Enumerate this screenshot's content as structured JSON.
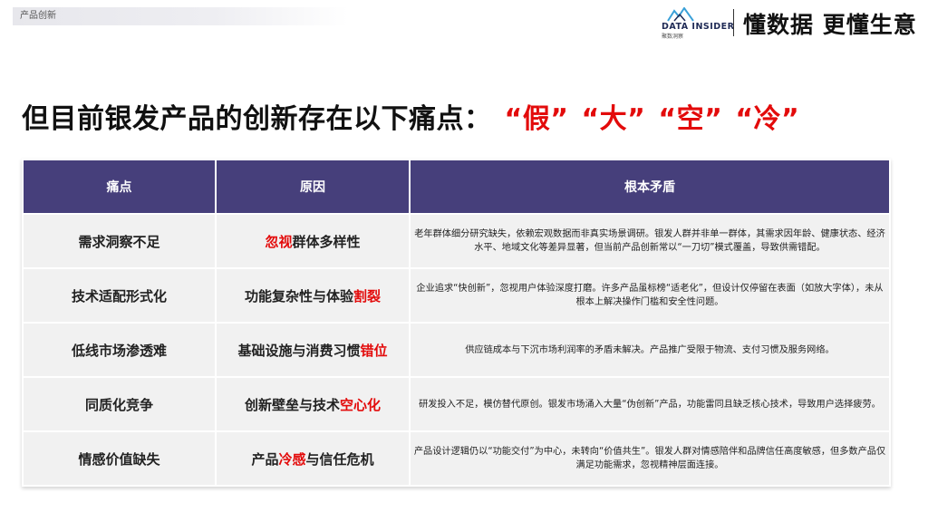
{
  "section_tag": "产品创新",
  "brand": {
    "name": "DATA INSIDER",
    "sub": "聚数洞察"
  },
  "slogan": "懂数据 更懂生意",
  "headline": {
    "main": "但目前银发产品的创新存在以下痛点：",
    "pains": [
      "“假”",
      "“大”",
      "“空”",
      "“冷”"
    ]
  },
  "table": {
    "headers": [
      "痛点",
      "原因",
      "根本矛盾"
    ],
    "rows": [
      {
        "pain": "需求洞察不足",
        "cause_pre": "",
        "cause_hl": "忽视",
        "cause_post": "群体多样性",
        "root": "老年群体细分研究缺失，依赖宏观数据而非真实场景调研。银发人群并非单一群体，其需求因年龄、健康状态、经济水平、地域文化等差异显著，但当前产品创新常以“一刀切”模式覆盖，导致供需错配。"
      },
      {
        "pain": "技术适配形式化",
        "cause_pre": "功能复杂性与体验",
        "cause_hl": "割裂",
        "cause_post": "",
        "root": "企业追求“快创新”，忽视用户体验深度打磨。许多产品虽标榜“适老化”，但设计仅停留在表面（如放大字体），未从根本上解决操作门槛和安全性问题。"
      },
      {
        "pain": "低线市场渗透难",
        "cause_pre": "基础设施与消费习惯",
        "cause_hl": "错位",
        "cause_post": "",
        "root": "供应链成本与下沉市场利润率的矛盾未解决。产品推广受限于物流、支付习惯及服务网络。"
      },
      {
        "pain": "同质化竞争",
        "cause_pre": "创新壁垒与技术",
        "cause_hl": "空心化",
        "cause_post": "",
        "root": "研发投入不足，模仿替代原创。银发市场涌入大量“伪创新”产品，功能雷同且缺乏核心技术，导致用户选择疲劳。"
      },
      {
        "pain": "情感价值缺失",
        "cause_pre": "产品",
        "cause_hl": "冷感",
        "cause_post": "与信任危机",
        "root": "产品设计逻辑仍以“功能交付”为中心，未转向“价值共生”。银发人群对情感陪伴和品牌信任高度敏感，但多数产品仅满足功能需求，忽视精神层面连接。"
      }
    ]
  },
  "colors": {
    "header_bg": "#463f7b",
    "cell_bg": "#f1f1f1",
    "highlight": "#e30b0b"
  }
}
